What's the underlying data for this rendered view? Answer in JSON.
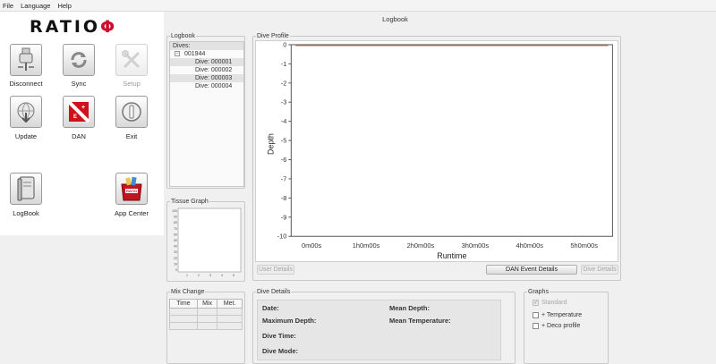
{
  "menu": [
    "File",
    "Language",
    "Help"
  ],
  "logo": {
    "text": "RATIO",
    "symbol": "Φ",
    "symbol_color": "#c8102e"
  },
  "window_title": "Logbook",
  "tiles": [
    {
      "label": "Disconnect",
      "icon": "usb-cable-icon",
      "enabled": true
    },
    {
      "label": "Sync",
      "icon": "sync-arrows-icon",
      "enabled": true
    },
    {
      "label": "Setup",
      "icon": "tools-icon",
      "enabled": false
    },
    {
      "label": "Update",
      "icon": "globe-download-icon",
      "enabled": true
    },
    {
      "label": "DAN",
      "icon": "dan-logo-icon",
      "enabled": true
    },
    {
      "label": "Exit",
      "icon": "power-icon",
      "enabled": true
    },
    {
      "label": "LogBook",
      "icon": "book-icon",
      "enabled": true
    },
    {
      "label": "App Center",
      "icon": "red-bag-icon",
      "enabled": true
    }
  ],
  "logbook": {
    "title": "Logbook",
    "root_label": "Dives:",
    "device": "001944",
    "expander": "−",
    "dives": [
      "Dive: 000001",
      "Dive: 000002",
      "Dive: 000003",
      "Dive: 000004"
    ]
  },
  "tissue_graph": {
    "title": "Tissue Graph",
    "y_ticks": [
      "100",
      "90",
      "80",
      "70",
      "60",
      "50",
      "40",
      "30",
      "20",
      "10",
      "0"
    ],
    "x_ticks": [
      "1",
      "2",
      "3",
      "4",
      "5"
    ]
  },
  "dive_profile": {
    "title": "Dive Profile"
  },
  "chart_data": {
    "type": "line",
    "ylabel": "Depth",
    "xlabel": "Runtime",
    "y_ticks": [
      "0",
      "-1",
      "-2",
      "-3",
      "-4",
      "-5",
      "-6",
      "-7",
      "-8",
      "-9",
      "-10"
    ],
    "x_ticks": [
      "0m00s",
      "1h0m00s",
      "2h0m00s",
      "3h0m00s",
      "4h0m00s",
      "5h0m00s"
    ],
    "ylim": [
      -10,
      0
    ],
    "series": [
      {
        "values": [
          0,
          0
        ],
        "color": "#c46a5a"
      }
    ]
  },
  "buttons": {
    "user_details": "User Details",
    "dan_event_details": "DAN Event Details",
    "dive_details": "Dive Details"
  },
  "mix_change": {
    "title": "Mix Change",
    "columns": [
      "Time",
      "Mix",
      "Met."
    ]
  },
  "dive_details": {
    "title": "Dive Details",
    "date": "Date:",
    "max_depth": "Maximum Depth:",
    "dive_time": "Dive Time:",
    "dive_mode": "Dive Mode:",
    "mean_depth": "Mean Depth:",
    "mean_temp": "Mean Temperature:"
  },
  "graphs": {
    "title": "Graphs",
    "standard": "Standard",
    "temperature": "+ Temperature",
    "deco": "+ Deco profile",
    "check_mark": "✓"
  }
}
